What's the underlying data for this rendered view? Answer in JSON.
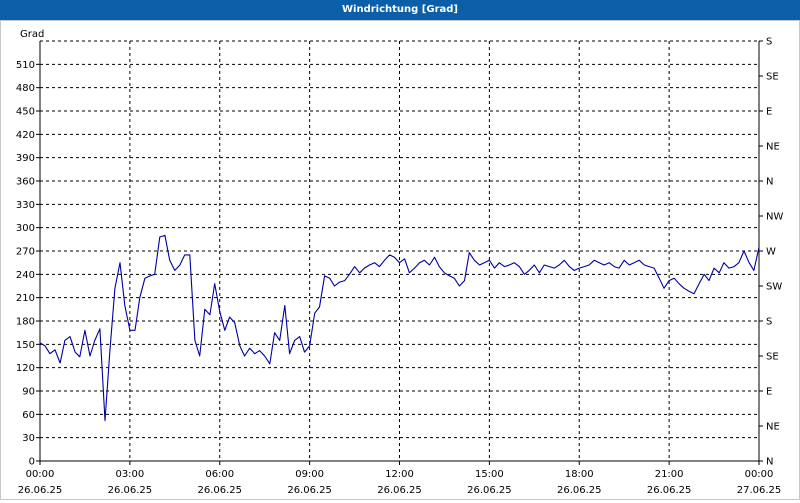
{
  "window": {
    "title": "Windrichtung [Grad]"
  },
  "chart_data": {
    "type": "line",
    "title": "Windrichtung [Grad]",
    "ylabel": "Grad",
    "ylim": [
      0,
      540
    ],
    "yticks": [
      0,
      30,
      60,
      90,
      120,
      150,
      180,
      210,
      240,
      270,
      300,
      330,
      360,
      390,
      420,
      450,
      480,
      510
    ],
    "right_axis_labels": [
      {
        "value": 0,
        "label": "N"
      },
      {
        "value": 45,
        "label": "NE"
      },
      {
        "value": 90,
        "label": "E"
      },
      {
        "value": 135,
        "label": "SE"
      },
      {
        "value": 180,
        "label": "S"
      },
      {
        "value": 225,
        "label": "SW"
      },
      {
        "value": 270,
        "label": "W"
      },
      {
        "value": 315,
        "label": "NW"
      },
      {
        "value": 360,
        "label": "N"
      },
      {
        "value": 405,
        "label": "NE"
      },
      {
        "value": 450,
        "label": "E"
      },
      {
        "value": 495,
        "label": "SE"
      },
      {
        "value": 540,
        "label": "S"
      }
    ],
    "xlim": [
      0,
      24
    ],
    "xticks": [
      {
        "value": 0,
        "time": "00:00",
        "date": "26.06.25"
      },
      {
        "value": 3,
        "time": "03:00",
        "date": "26.06.25"
      },
      {
        "value": 6,
        "time": "06:00",
        "date": "26.06.25"
      },
      {
        "value": 9,
        "time": "09:00",
        "date": "26.06.25"
      },
      {
        "value": 12,
        "time": "12:00",
        "date": "26.06.25"
      },
      {
        "value": 15,
        "time": "15:00",
        "date": "26.06.25"
      },
      {
        "value": 18,
        "time": "18:00",
        "date": "26.06.25"
      },
      {
        "value": 21,
        "time": "21:00",
        "date": "26.06.25"
      },
      {
        "value": 24,
        "time": "00:00",
        "date": "27.06.25"
      }
    ],
    "grid": true,
    "series": [
      {
        "color": "#0000a0",
        "x": [
          0,
          0.17,
          0.33,
          0.5,
          0.67,
          0.83,
          1.0,
          1.17,
          1.33,
          1.5,
          1.67,
          1.83,
          2.0,
          2.17,
          2.33,
          2.5,
          2.67,
          2.83,
          3.0,
          3.17,
          3.33,
          3.5,
          3.67,
          3.83,
          4.0,
          4.17,
          4.33,
          4.5,
          4.67,
          4.83,
          5.0,
          5.17,
          5.33,
          5.5,
          5.67,
          5.83,
          6.0,
          6.17,
          6.33,
          6.5,
          6.67,
          6.83,
          7.0,
          7.17,
          7.33,
          7.5,
          7.67,
          7.83,
          8.0,
          8.17,
          8.33,
          8.5,
          8.67,
          8.83,
          9.0,
          9.17,
          9.33,
          9.5,
          9.67,
          9.83,
          10.0,
          10.17,
          10.33,
          10.5,
          10.67,
          10.83,
          11.0,
          11.17,
          11.33,
          11.5,
          11.67,
          11.83,
          12.0,
          12.17,
          12.33,
          12.5,
          12.67,
          12.83,
          13.0,
          13.17,
          13.33,
          13.5,
          13.67,
          13.83,
          14.0,
          14.17,
          14.33,
          14.5,
          14.67,
          14.83,
          15.0,
          15.17,
          15.33,
          15.5,
          15.67,
          15.83,
          16.0,
          16.17,
          16.33,
          16.5,
          16.67,
          16.83,
          17.0,
          17.17,
          17.33,
          17.5,
          17.67,
          17.83,
          18.0,
          18.17,
          18.33,
          18.5,
          18.67,
          18.83,
          19.0,
          19.17,
          19.33,
          19.5,
          19.67,
          19.83,
          20.0,
          20.17,
          20.33,
          20.5,
          20.67,
          20.83,
          21.0,
          21.17,
          21.33,
          21.5,
          21.67,
          21.83,
          22.0,
          22.17,
          22.33,
          22.5,
          22.67,
          22.83,
          23.0,
          23.17,
          23.33,
          23.5,
          23.67,
          23.83,
          24.0
        ],
        "y": [
          152,
          148,
          138,
          143,
          126,
          155,
          160,
          140,
          134,
          168,
          135,
          155,
          170,
          52,
          140,
          222,
          255,
          200,
          168,
          168,
          210,
          235,
          238,
          240,
          288,
          290,
          258,
          245,
          252,
          265,
          265,
          155,
          135,
          195,
          188,
          228,
          192,
          168,
          185,
          178,
          148,
          135,
          145,
          138,
          142,
          135,
          125,
          165,
          155,
          200,
          138,
          155,
          160,
          140,
          148,
          190,
          198,
          238,
          235,
          225,
          230,
          232,
          240,
          250,
          242,
          248,
          252,
          255,
          250,
          258,
          265,
          262,
          255,
          260,
          242,
          248,
          255,
          258,
          252,
          262,
          250,
          242,
          238,
          235,
          225,
          232,
          268,
          258,
          252,
          255,
          258,
          248,
          255,
          250,
          252,
          255,
          250,
          240,
          245,
          252,
          242,
          252,
          250,
          248,
          252,
          258,
          250,
          245,
          248,
          250,
          252,
          258,
          255,
          252,
          255,
          250,
          248,
          258,
          252,
          255,
          258,
          252,
          250,
          248,
          235,
          222,
          232,
          235,
          228,
          222,
          218,
          215,
          228,
          240,
          232,
          248,
          242,
          255,
          248,
          250,
          255,
          270,
          255,
          245,
          275
        ]
      }
    ]
  }
}
